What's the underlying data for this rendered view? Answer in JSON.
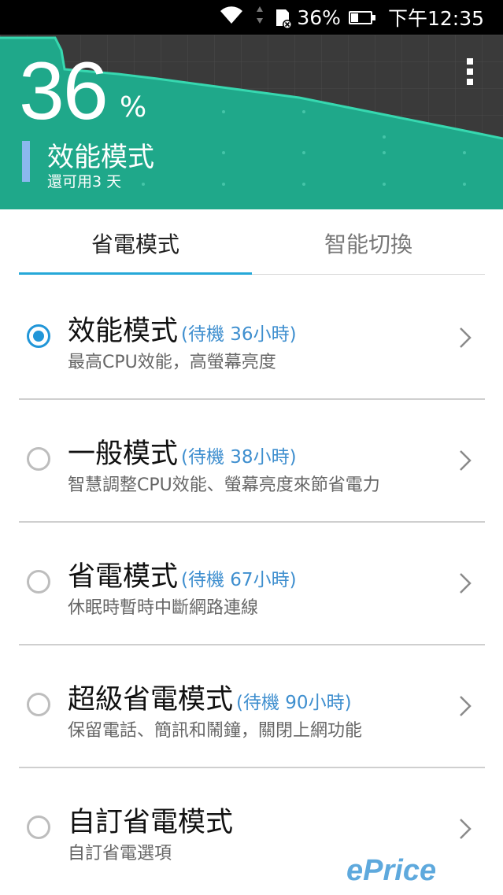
{
  "status_bar": {
    "battery_percent": "36%",
    "battery_level": 0.36,
    "time": "下午12:35"
  },
  "header": {
    "percent_value": "36",
    "percent_sign": "%",
    "mode_title": "效能模式",
    "remaining": "還可用3 天",
    "colors": {
      "graph_fill": "#1fa88a",
      "graph_line": "#37d8b0",
      "mode_bar": "#8ab8ee"
    }
  },
  "tabs": [
    {
      "label": "省電模式",
      "active": true
    },
    {
      "label": "智能切換",
      "active": false
    }
  ],
  "modes": [
    {
      "title": "效能模式",
      "standby": "(待機 36小時)",
      "desc": "最高CPU效能，高螢幕亮度",
      "selected": true
    },
    {
      "title": "一般模式",
      "standby": "(待機 38小時)",
      "desc": "智慧調整CPU效能、螢幕亮度來節省電力",
      "selected": false
    },
    {
      "title": "省電模式",
      "standby": "(待機 67小時)",
      "desc": "休眠時暫時中斷網路連線",
      "selected": false
    },
    {
      "title": "超級省電模式",
      "standby": "(待機 90小時)",
      "desc": "保留電話、簡訊和鬧鐘，關閉上網功能",
      "selected": false
    },
    {
      "title": "自訂省電模式",
      "standby": "",
      "desc": "自訂省電選項",
      "selected": false
    }
  ],
  "watermark": "ePrice",
  "accent_color": "#2196d8"
}
